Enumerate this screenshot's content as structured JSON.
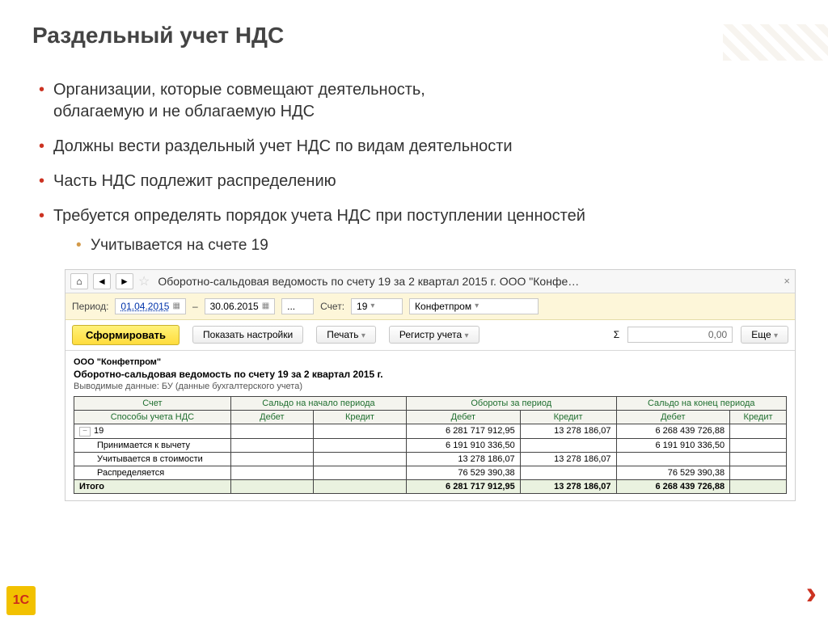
{
  "title": "Раздельный учет НДС",
  "bullets": {
    "b1a": "Организации, которые совмещают деятельность,",
    "b1b": "облагаемую и не облагаемую НДС",
    "b2": "Должны вести раздельный учет НДС по видам деятельности",
    "b3": "Часть НДС подлежит распределению",
    "b4": "Требуется определять порядок учета НДС при поступлении ценностей",
    "sub1": "Учитывается на счете 19"
  },
  "shot": {
    "tab_title": "Оборотно-сальдовая ведомость по счету 19 за 2 квартал 2015 г. ООО \"Конфе…",
    "home_glyph": "⌂",
    "star_glyph": "☆",
    "close_glyph": "×",
    "params": {
      "period_lbl": "Период:",
      "date_from": "01.04.2015",
      "dash": "–",
      "date_to": "30.06.2015",
      "dots": "...",
      "account_lbl": "Счет:",
      "account_val": "19",
      "org": "Конфетпром"
    },
    "toolbar": {
      "form": "Сформировать",
      "settings": "Показать настройки",
      "print": "Печать",
      "register": "Регистр учета",
      "sigma": "Σ",
      "find_val": "0,00",
      "more": "Еще"
    },
    "report": {
      "org": "ООО \"Конфетпром\"",
      "title": "Оборотно-сальдовая ведомость по счету 19 за 2 квартал 2015 г.",
      "sub": "Выводимые данные: БУ (данные бухгалтерского учета)",
      "head_account": "Счет",
      "head_account2": "Способы учета НДС",
      "grp_start": "Сальдо на начало периода",
      "grp_period": "Обороты за период",
      "grp_end": "Сальдо на конец периода",
      "debit": "Дебет",
      "credit": "Кредит",
      "rows": [
        {
          "n": "19",
          "d2": "6 281 717 912,95",
          "c2": "13 278 186,07",
          "d3": "6 268 439 726,88"
        },
        {
          "n": "Принимается к вычету",
          "d2": "6 191 910 336,50",
          "c2": "",
          "d3": "6 191 910 336,50"
        },
        {
          "n": "Учитывается в стоимости",
          "d2": "13 278 186,07",
          "c2": "13 278 186,07",
          "d3": ""
        },
        {
          "n": "Распределяется",
          "d2": "76 529 390,38",
          "c2": "",
          "d3": "76 529 390,38"
        }
      ],
      "total": {
        "n": "Итого",
        "d2": "6 281 717 912,95",
        "c2": "13 278 186,07",
        "d3": "6 268 439 726,88"
      }
    }
  },
  "logo": "1C",
  "chev": "›"
}
